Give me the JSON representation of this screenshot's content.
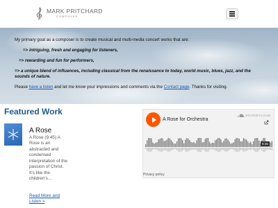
{
  "header": {
    "logo_name": "MARK PRITCHARD",
    "logo_sub": "COMPOSER"
  },
  "hero": {
    "intro": "My primary goal as a composer is to create musical and multi-media concert works that are:",
    "point1": "=> intriguing, fresh and engaging for listeners,",
    "point2": "=> rewarding and fun for performers,",
    "point3": "=> a unique blend of influences, including classical from the renaissance to today, world music, blues, jazz, and the sounds of nature.",
    "please_text_1": "Please ",
    "listen_link": "have a listen",
    "please_text_2": " and let me know your impressions and comments via the ",
    "contact_link": "Contact page",
    "please_text_3": ". Thanks for visiting."
  },
  "featured": {
    "heading": "Featured Work",
    "work_title": "A Rose",
    "work_desc": "A Rose (9:45) A Rose is an abstracted and condensed interpretation of the passion of Christ. It's like the children's…",
    "work_link": "Read More and Listen »"
  },
  "soundcloud": {
    "track_title": "A Rose for Orchestra",
    "brand": "SOUNDCLOUD",
    "duration": "9:45",
    "privacy": "Privacy policy",
    "accent": "#ff5500"
  }
}
